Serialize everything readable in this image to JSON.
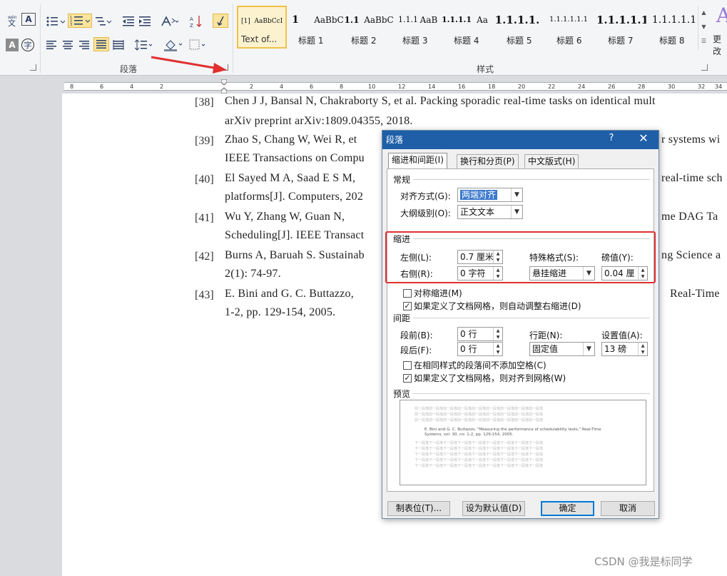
{
  "ribbon": {
    "paragraph_group_label": "段落",
    "styles_group_label": "样式",
    "more_label": "更改",
    "style_gallery": [
      {
        "sample": "AaBbCcI",
        "name": "Text of...",
        "prefix": "[1]",
        "selected": true
      },
      {
        "sample": "1",
        "name": "标题 1",
        "selected": false
      },
      {
        "sample": "AaBbC",
        "name": "标题 2",
        "selected": false
      },
      {
        "sample": "1.1",
        "name": "标题 3",
        "selected": false
      },
      {
        "sample": "AaBbC",
        "name": "标题 4",
        "selected": false
      },
      {
        "sample": "1.1.1",
        "name": "标题 5",
        "selected": false
      },
      {
        "sample": "AaB",
        "name": "标题 6",
        "selected": false
      },
      {
        "sample": "1.1.1.1",
        "name": "标题 7",
        "selected": false
      },
      {
        "sample": "Aa",
        "name": "标题 8",
        "selected": false
      }
    ],
    "style_gallery_row2": [
      "1.1.1.1.",
      "1.1.1.1.1.1",
      "1.1.1.1.1.",
      "1.1.1.1.1"
    ]
  },
  "ruler": {
    "labels": [
      "8",
      "6",
      "4",
      "2",
      "2",
      "4",
      "6",
      "8",
      "10",
      "12",
      "14",
      "16",
      "18",
      "20",
      "22",
      "24",
      "26",
      "28",
      "30",
      "32",
      "34"
    ]
  },
  "document": {
    "references": [
      {
        "num": "[38]",
        "lines": [
          "Chen J J, Bansal N, Chakraborty S, et al. Packing sporadic real-time tasks on identical mult",
          "arXiv preprint arXiv:1809.04355, 2018."
        ]
      },
      {
        "num": "[39]",
        "lines": [
          "Zhao S, Chang W, Wei R, et",
          "IEEE Transactions on Compu"
        ],
        "tail": [
          "r systems wi",
          ""
        ]
      },
      {
        "num": "[40]",
        "lines": [
          "El Sayed M A, Saad E S M, ",
          "platforms[J]. Computers, 202"
        ],
        "tail": [
          "real-time sch",
          ""
        ]
      },
      {
        "num": "[41]",
        "lines": [
          "Wu Y, Zhang W, Guan N, ",
          "Scheduling[J]. IEEE Transact"
        ],
        "tail": [
          "me DAG Ta",
          ""
        ]
      },
      {
        "num": "[42]",
        "lines": [
          "Burns A, Baruah S. Sustainab",
          "2(1): 74-97."
        ],
        "tail": [
          "ng Science a",
          ""
        ]
      },
      {
        "num": "[43]",
        "lines": [
          "E. Bini and G. C. Buttazzo, ",
          "1-2, pp. 129-154, 2005."
        ],
        "tail": [
          "Real-Time",
          ""
        ]
      }
    ]
  },
  "dialog": {
    "title": "段落",
    "help": "?",
    "close": "✕",
    "tabs": [
      {
        "label": "缩进和间距(I)",
        "active": true
      },
      {
        "label": "换行和分页(P)",
        "active": false
      },
      {
        "label": "中文版式(H)",
        "active": false
      }
    ],
    "general": {
      "title": "常规",
      "alignment_label": "对齐方式(G):",
      "alignment_value": "两端对齐",
      "outline_label": "大纲级别(O):",
      "outline_value": "正文文本"
    },
    "indent": {
      "title": "缩进",
      "left_label": "左侧(L):",
      "left_value": "0.7 厘米",
      "right_label": "右侧(R):",
      "right_value": "0 字符",
      "special_label": "特殊格式(S):",
      "special_value": "悬挂缩进",
      "by_label": "磅值(Y):",
      "by_value": "0.04 厘",
      "mirror_label": "对称缩进(M)",
      "mirror_checked": false,
      "auto_right_label": "如果定义了文档网格，则自动调整右缩进(D)",
      "auto_right_checked": true
    },
    "spacing": {
      "title": "间距",
      "before_label": "段前(B):",
      "before_value": "0 行",
      "after_label": "段后(F):",
      "after_value": "0 行",
      "line_label": "行距(N):",
      "line_value": "固定值",
      "at_label": "设置值(A):",
      "at_value": "13 磅",
      "no_space_label": "在相同样式的段落间不添加空格(C)",
      "no_space_checked": false,
      "snap_grid_label": "如果定义了文档网格，则对齐到网格(W)",
      "snap_grid_checked": true
    },
    "preview": {
      "title": "预览",
      "prev_text": "前一段落前一段落前一段落前一段落前一段落前一段落前一段落前一段落前一段落",
      "sample_line1": "E. Bini and G. C. Buttazzo, \"Measuring the performance of schedulability tests,\" Real-Time",
      "sample_line2": "Systems, vol. 30, no. 1-2, pp. 129-154, 2005.",
      "next_text": "下一段落下一段落下一段落下一段落下一段落下一段落下一段落下一段落下一段落"
    },
    "buttons": {
      "tabs": "制表位(T)...",
      "set_default": "设为默认值(D)",
      "ok": "确定",
      "cancel": "取消"
    }
  },
  "watermark": "CSDN @我是标同学",
  "colors": {
    "titlebar": "#1e5fa8",
    "highlight_box": "#e03030",
    "arrow": "#e03030",
    "selected_style": "#fdf2cf"
  }
}
